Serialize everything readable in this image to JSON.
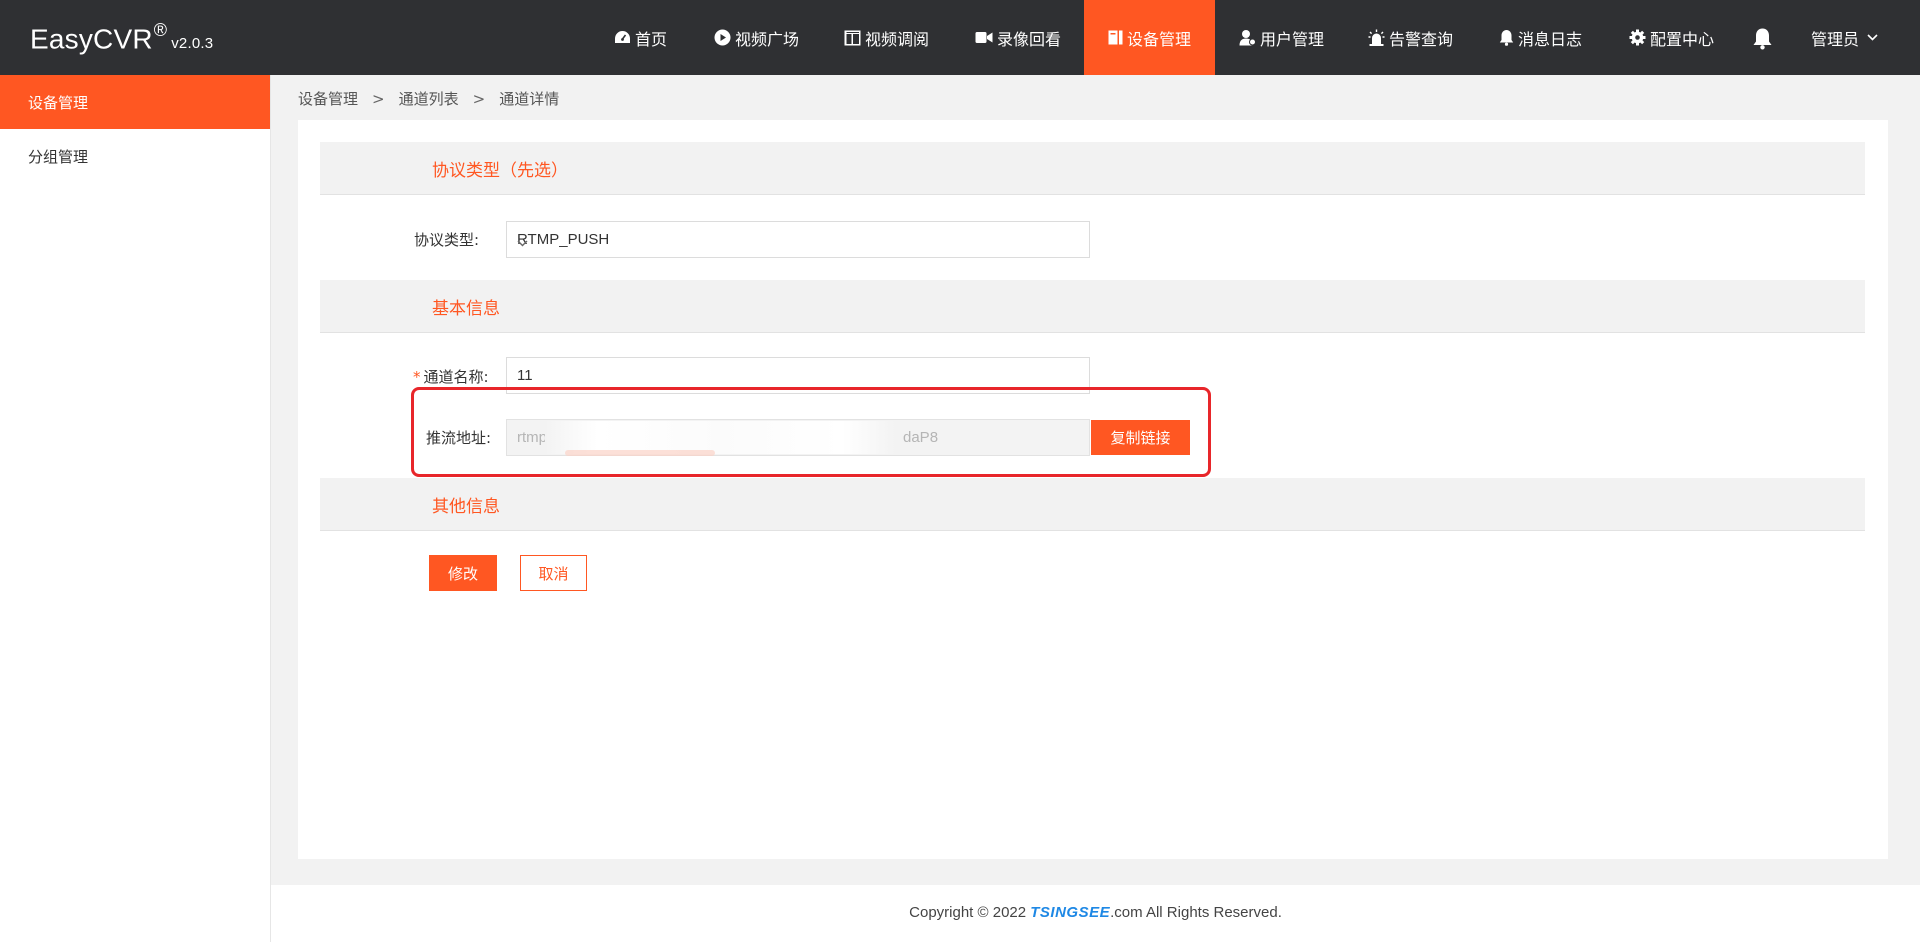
{
  "app": {
    "logo_text": "EasyCVR",
    "logo_reg": "®",
    "version": "v2.0.3"
  },
  "nav": {
    "items": [
      {
        "label": "首页",
        "icon": "dashboard-icon"
      },
      {
        "label": "视频广场",
        "icon": "play-circle-icon"
      },
      {
        "label": "视频调阅",
        "icon": "layout-icon"
      },
      {
        "label": "录像回看",
        "icon": "video-camera-icon"
      },
      {
        "label": "设备管理",
        "icon": "device-icon",
        "active": true
      },
      {
        "label": "用户管理",
        "icon": "user-icon"
      },
      {
        "label": "告警查询",
        "icon": "alarm-icon"
      },
      {
        "label": "消息日志",
        "icon": "bell-small-icon"
      },
      {
        "label": "配置中心",
        "icon": "gear-icon"
      }
    ],
    "notification_icon": "bell-icon",
    "user_label": "管理员"
  },
  "sidebar": {
    "items": [
      {
        "label": "设备管理",
        "active": true
      },
      {
        "label": "分组管理"
      }
    ]
  },
  "breadcrumb": {
    "items": [
      "设备管理",
      "通道列表",
      "通道详情"
    ],
    "separator": ">"
  },
  "form": {
    "section_protocol": "协议类型（先选）",
    "protocol_label": "协议类型:",
    "protocol_value": "RTMP_PUSH",
    "section_basic": "基本信息",
    "required_mark": "*",
    "channel_name_label": "通道名称:",
    "channel_name_value": "11",
    "push_url_label": "推流地址:",
    "push_url_prefix": "rtmp",
    "push_url_suffix": "daP8",
    "copy_button": "复制链接",
    "section_other": "其他信息",
    "modify_button": "修改",
    "cancel_button": "取消"
  },
  "footer": {
    "copyright_prefix": "Copyright © 2022 ",
    "brand": "TSINGSEE",
    "copyright_suffix": ".com All Rights Reserved."
  },
  "colors": {
    "accent": "#ff5722",
    "topbar": "#2f3033",
    "highlight_box": "#e8262a"
  }
}
